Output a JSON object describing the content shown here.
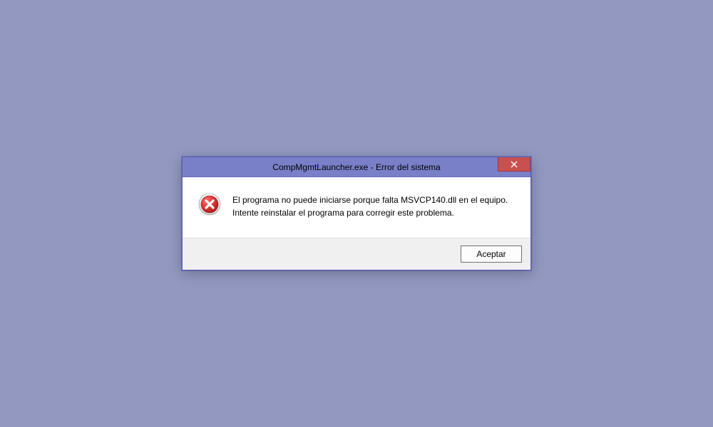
{
  "dialog": {
    "title": "CompMgmtLauncher.exe - Error del sistema",
    "message_line1": "El programa no puede iniciarse porque falta MSVCP140.dll en el equipo.",
    "message_line2": "Intente reinstalar el programa para corregir este problema.",
    "accept_label": "Aceptar"
  },
  "colors": {
    "desktop_bg": "#9298c0",
    "titlebar_bg": "#7a80c8",
    "close_bg": "#c8504f",
    "footer_bg": "#f0f0f0"
  }
}
